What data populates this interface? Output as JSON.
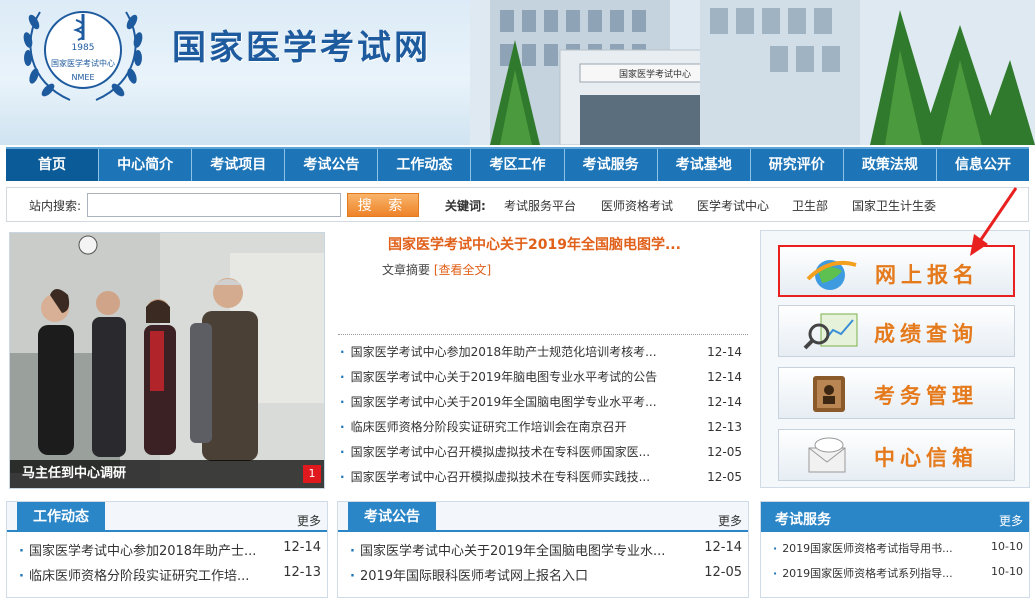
{
  "header": {
    "site_title": "国家医学考试网",
    "logo": {
      "year": "1985",
      "org": "国家医学考试中心",
      "abbr": "NMEE"
    },
    "building_sign": "国家医学考试中心"
  },
  "nav": [
    "首页",
    "中心简介",
    "考试项目",
    "考试公告",
    "工作动态",
    "考区工作",
    "考试服务",
    "考试基地",
    "研究评价",
    "政策法规",
    "信息公开"
  ],
  "search": {
    "label": "站内搜索:",
    "value": "",
    "button": "搜 索",
    "keywords_label": "关键词:",
    "keywords": [
      "考试服务平台",
      "医师资格考试",
      "医学考试中心",
      "卫生部",
      "国家卫生计生委"
    ]
  },
  "slide": {
    "caption": "马主任到中心调研",
    "index": "1"
  },
  "headline": {
    "title": "国家医学考试中心关于2019年全国脑电图学...",
    "summary_label": "文章摘要",
    "read_more": "[查看全文]"
  },
  "news": [
    {
      "title": "国家医学考试中心参加2018年助产士规范化培训考核考...",
      "date": "12-14"
    },
    {
      "title": "国家医学考试中心关于2019年脑电图专业水平考试的公告",
      "date": "12-14"
    },
    {
      "title": "国家医学考试中心关于2019年全国脑电图学专业水平考...",
      "date": "12-14"
    },
    {
      "title": "临床医师资格分阶段实证研究工作培训会在南京召开",
      "date": "12-13"
    },
    {
      "title": "国家医学考试中心召开模拟虚拟技术在专科医师国家医...",
      "date": "12-05"
    },
    {
      "title": "国家医学考试中心召开模拟虚拟技术在专科医师实践技...",
      "date": "12-05"
    }
  ],
  "services": [
    {
      "label": "网上报名",
      "icon": "globe-icon",
      "highlight": true
    },
    {
      "label": "成绩查询",
      "icon": "magnifier-chart-icon",
      "highlight": false
    },
    {
      "label": "考务管理",
      "icon": "folder-book-icon",
      "highlight": false
    },
    {
      "label": "中心信箱",
      "icon": "mail-envelope-icon",
      "highlight": false
    }
  ],
  "boxes": {
    "work": {
      "title": "工作动态",
      "more": "更多",
      "items": [
        {
          "title": "国家医学考试中心参加2018年助产士...",
          "date": "12-14"
        },
        {
          "title": "临床医师资格分阶段实证研究工作培...",
          "date": "12-13"
        }
      ]
    },
    "notice": {
      "title": "考试公告",
      "more": "更多",
      "items": [
        {
          "title": "国家医学考试中心关于2019年全国脑电图学专业水...",
          "date": "12-14"
        },
        {
          "title": "2019年国际眼科医师考试网上报名入口",
          "date": "12-05"
        }
      ]
    },
    "service": {
      "title": "考试服务",
      "more": "更多",
      "items": [
        {
          "title": "2019国家医师资格考试指导用书...",
          "date": "10-10"
        },
        {
          "title": "2019国家医师资格考试系列指导...",
          "date": "10-10"
        }
      ]
    }
  },
  "colors": {
    "nav_blue": "#1d75b8",
    "accent_orange": "#e57a1c",
    "highlight_red": "#e8211f"
  }
}
